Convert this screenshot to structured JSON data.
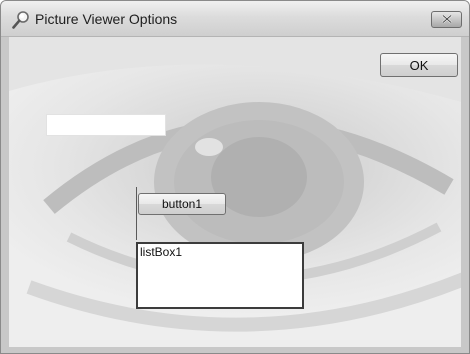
{
  "window": {
    "title": "Picture Viewer Options",
    "title_icon": "magnifier-icon",
    "close_icon": "close-icon"
  },
  "form": {
    "ok_label": "OK",
    "button1_label": "button1",
    "textbox_value": "",
    "listbox_items": [
      "listBox1"
    ]
  },
  "colors": {
    "client_background": "#dcdcdc",
    "titlebar": "#dcdcdc",
    "control_border": "#3c3c3c"
  }
}
